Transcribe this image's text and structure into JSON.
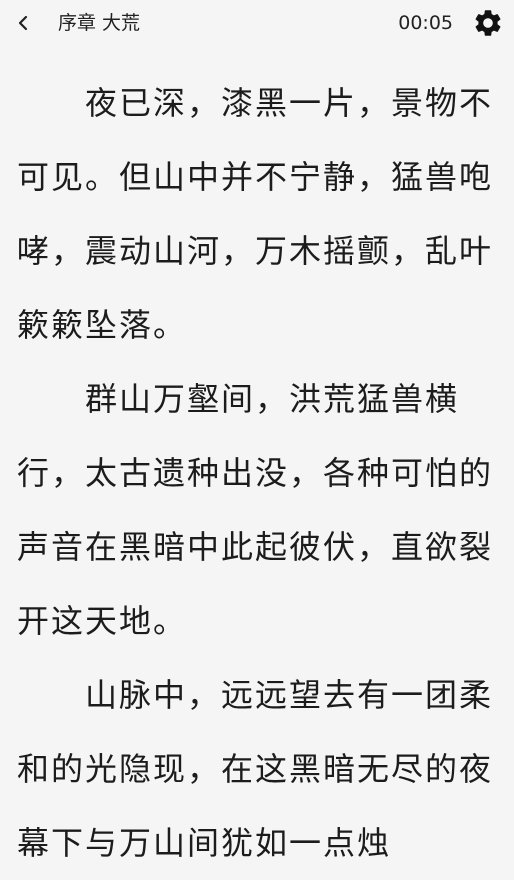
{
  "header": {
    "back_icon": "chevron-left-icon",
    "chapter_title": "序章 大荒",
    "time": "00:05",
    "settings_icon": "gear-icon"
  },
  "content": {
    "paragraphs": [
      "夜已深，漆黑一片，景物不可见。但山中并不宁静，猛兽咆哮，震动山河，万木摇颤，乱叶簌簌坠落。",
      "群山万壑间，洪荒猛兽横行，太古遗种出没，各种可怕的声音在黑暗中此起彼伏，直欲裂开这天地。",
      "山脉中，远远望去有一团柔和的光隐现，在这黑暗无尽的夜幕下与万山间犹如一点烛"
    ]
  }
}
